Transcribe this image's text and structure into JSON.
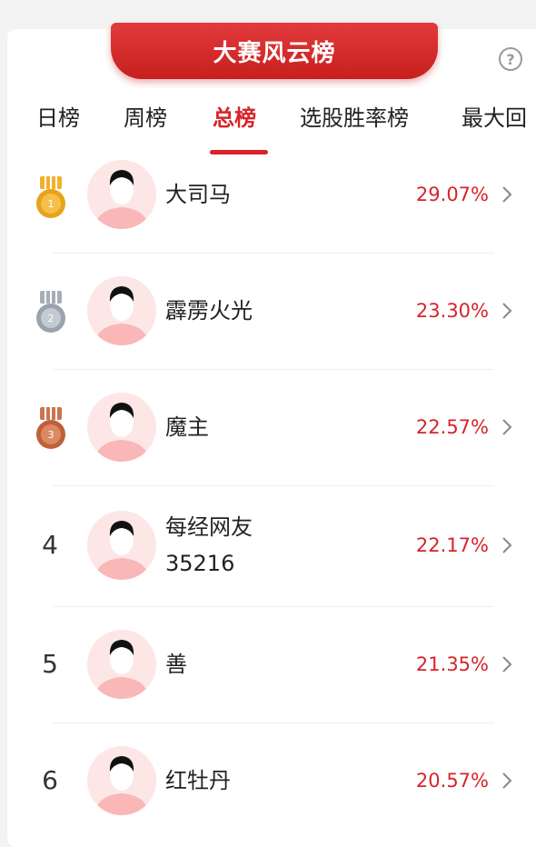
{
  "header": {
    "title": "大赛风云榜",
    "help_symbol": "?"
  },
  "tabs": [
    {
      "label": "日榜"
    },
    {
      "label": "周榜"
    },
    {
      "label": "总榜",
      "active": true
    },
    {
      "label": "选股胜率榜"
    },
    {
      "label": "最大回"
    }
  ],
  "leaderboard": [
    {
      "rank": "1",
      "medal": "gold",
      "name": "大司马",
      "pct": "29.07%"
    },
    {
      "rank": "2",
      "medal": "silver",
      "name": "霹雳火光",
      "pct": "23.30%"
    },
    {
      "rank": "3",
      "medal": "bronze",
      "name": "魔主",
      "pct": "22.57%"
    },
    {
      "rank": "4",
      "medal": "",
      "name": "每经网友\n35216",
      "pct": "22.17%"
    },
    {
      "rank": "5",
      "medal": "",
      "name": "善",
      "pct": "21.35%"
    },
    {
      "rank": "6",
      "medal": "",
      "name": "红牡丹",
      "pct": "20.57%"
    }
  ],
  "colors": {
    "accent": "#d8232a",
    "gold": "#e8a21c",
    "silver": "#9aa3ad",
    "bronze": "#c0603a"
  },
  "icons": {
    "help": "question-circle-icon",
    "chevron": "chevron-right-icon",
    "avatar": "default-avatar-icon"
  }
}
